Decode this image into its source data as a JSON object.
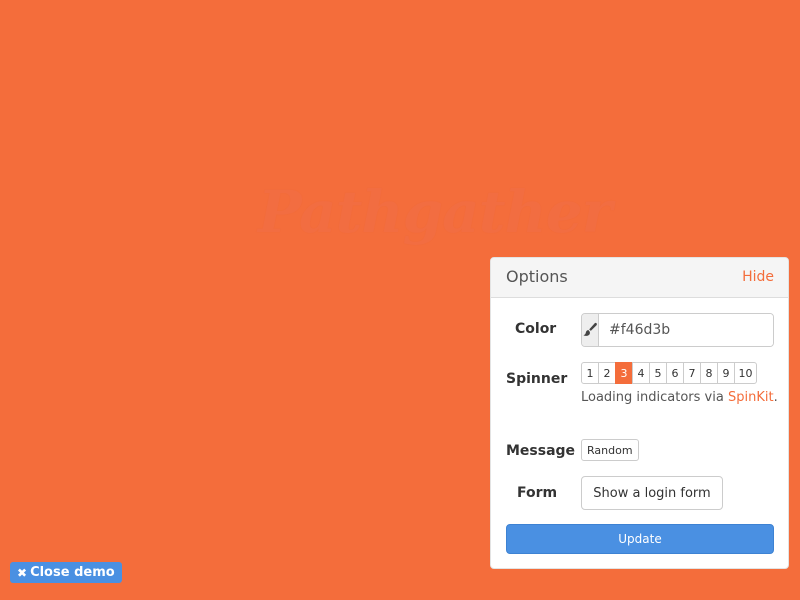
{
  "background": {
    "color": "#f46d3b",
    "logo_text": "Pathgather"
  },
  "options_panel": {
    "title": "Options",
    "hide_label": "Hide",
    "color": {
      "label": "Color",
      "icon": "paintbrush-icon",
      "value": "#f46d3b"
    },
    "spinner": {
      "label": "Spinner",
      "options": [
        "1",
        "2",
        "3",
        "4",
        "5",
        "6",
        "7",
        "8",
        "9",
        "10"
      ],
      "selected": "3",
      "note_prefix": "Loading indicators via ",
      "note_link": "SpinKit",
      "note_suffix": "."
    },
    "message": {
      "label": "Message",
      "button_label": "Random"
    },
    "form": {
      "label": "Form",
      "button_label": "Show a login form"
    },
    "update_label": "Update"
  },
  "close_demo": {
    "icon": "close-icon",
    "label": "Close demo"
  },
  "colors": {
    "accent": "#f46d3b",
    "primary_button": "#4a90e2"
  }
}
